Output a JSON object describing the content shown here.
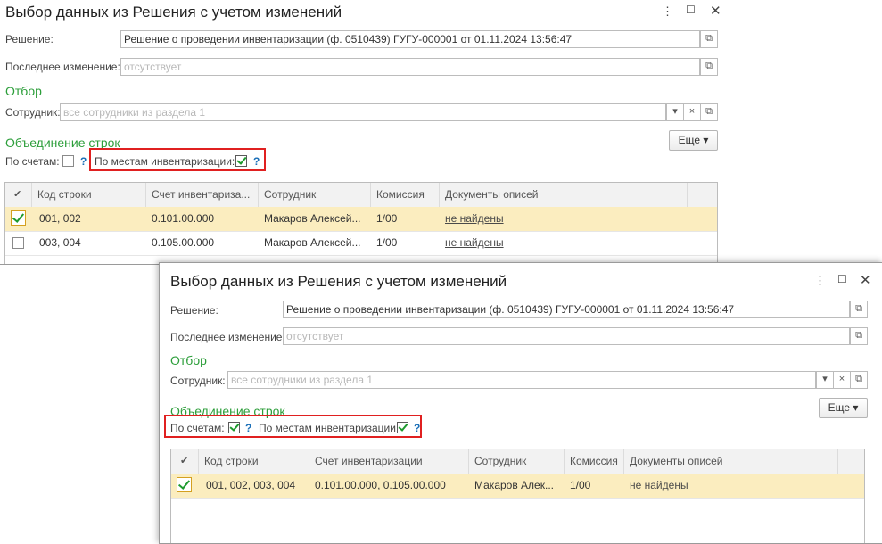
{
  "windows": [
    {
      "title": "Выбор данных из Решения с учетом изменений",
      "decision_label": "Решение:",
      "decision_value": "Решение о проведении инвентаризации (ф. 0510439) ГУГУ-000001 от 01.11.2024 13:56:47",
      "last_change_label": "Последнее изменение:",
      "last_change_placeholder": "отсутствует",
      "filter_section": "Отбор",
      "employee_label": "Сотрудник:",
      "employee_placeholder": "все сотрудники из раздела 1",
      "merge_section": "Объединение строк",
      "by_accounts_label": "По счетам:",
      "by_accounts_checked": false,
      "by_places_label": "По местам инвентаризации:",
      "by_places_checked": true,
      "more_button": "Еще",
      "columns": [
        "Код строки",
        "Счет инвентаризации",
        "Сотрудник",
        "Комиссия",
        "Документы описей"
      ],
      "column_display": [
        "Код строки",
        "Счет инвентариза...",
        "Сотрудник",
        "Комиссия",
        "Документы описей"
      ],
      "rows": [
        {
          "checked": true,
          "code": "001, 002",
          "account": "0.101.00.000",
          "employee": "Макаров Алексей...",
          "commission": "1/00",
          "docs": "не найдены"
        },
        {
          "checked": false,
          "code": "003, 004",
          "account": "0.105.00.000",
          "employee": "Макаров Алексей...",
          "commission": "1/00",
          "docs": "не найдены"
        }
      ]
    },
    {
      "title": "Выбор данных из Решения с учетом изменений",
      "decision_label": "Решение:",
      "decision_value": "Решение о проведении инвентаризации (ф. 0510439) ГУГУ-000001 от 01.11.2024 13:56:47",
      "last_change_label": "Последнее изменение:",
      "last_change_placeholder": "отсутствует",
      "filter_section": "Отбор",
      "employee_label": "Сотрудник:",
      "employee_placeholder": "все сотрудники из раздела 1",
      "merge_section": "Объединение строк",
      "by_accounts_label": "По счетам:",
      "by_accounts_checked": true,
      "by_places_label": "По местам инвентаризации:",
      "by_places_checked": true,
      "more_button": "Еще",
      "columns": [
        "Код строки",
        "Счет инвентаризации",
        "Сотрудник",
        "Комиссия",
        "Документы описей"
      ],
      "rows": [
        {
          "checked": true,
          "code": "001, 002, 003, 004",
          "account": "0.101.00.000, 0.105.00.000",
          "employee": "Макаров Алек...",
          "commission": "1/00",
          "docs": "не найдены"
        }
      ]
    }
  ],
  "icons": {
    "menu": "kebab-menu-icon",
    "maximize": "maximize-icon",
    "close": "close-icon",
    "open": "open-form-icon",
    "dropdown": "chevron-down-icon",
    "clear": "clear-icon",
    "help": "help-question-icon"
  },
  "accent_colors": {
    "section": "#2c9e3a",
    "highlight_border": "#e02020",
    "selected_row": "#fbedbf",
    "help": "#1a6fb8"
  }
}
